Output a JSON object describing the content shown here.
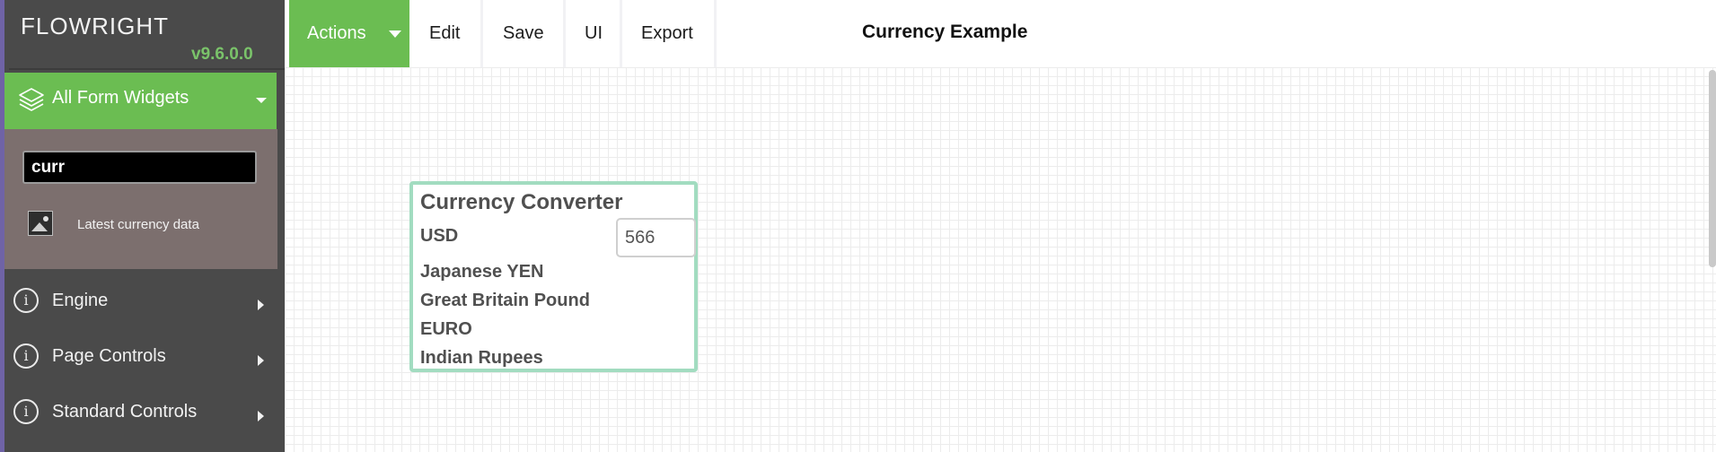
{
  "app": {
    "logo_text": "FLOWRIGHT",
    "version": "v9.6.0.0",
    "accent_color": "#6bbd52",
    "sidebar_color": "#4a4a4a"
  },
  "sidebar": {
    "widgets_header": {
      "label": "All Form Widgets",
      "icon": "layers-icon"
    },
    "search": {
      "value": "curr",
      "placeholder": ""
    },
    "results": [
      {
        "label": "Latest currency data",
        "icon": "image-icon"
      }
    ],
    "nav": [
      {
        "label": "Engine",
        "icon": "info-icon"
      },
      {
        "label": "Page Controls",
        "icon": "info-icon"
      },
      {
        "label": "Standard Controls",
        "icon": "info-icon"
      }
    ]
  },
  "toolbar": {
    "actions_label": "Actions",
    "edit_label": "Edit",
    "save_label": "Save",
    "ui_label": "UI",
    "export_label": "Export",
    "page_title": "Currency Example"
  },
  "widget": {
    "title": "Currency Converter",
    "usd_label": "USD",
    "usd_value": "566",
    "rows": [
      "Japanese YEN",
      "Great Britain Pound",
      "EURO",
      "Indian Rupees"
    ]
  }
}
